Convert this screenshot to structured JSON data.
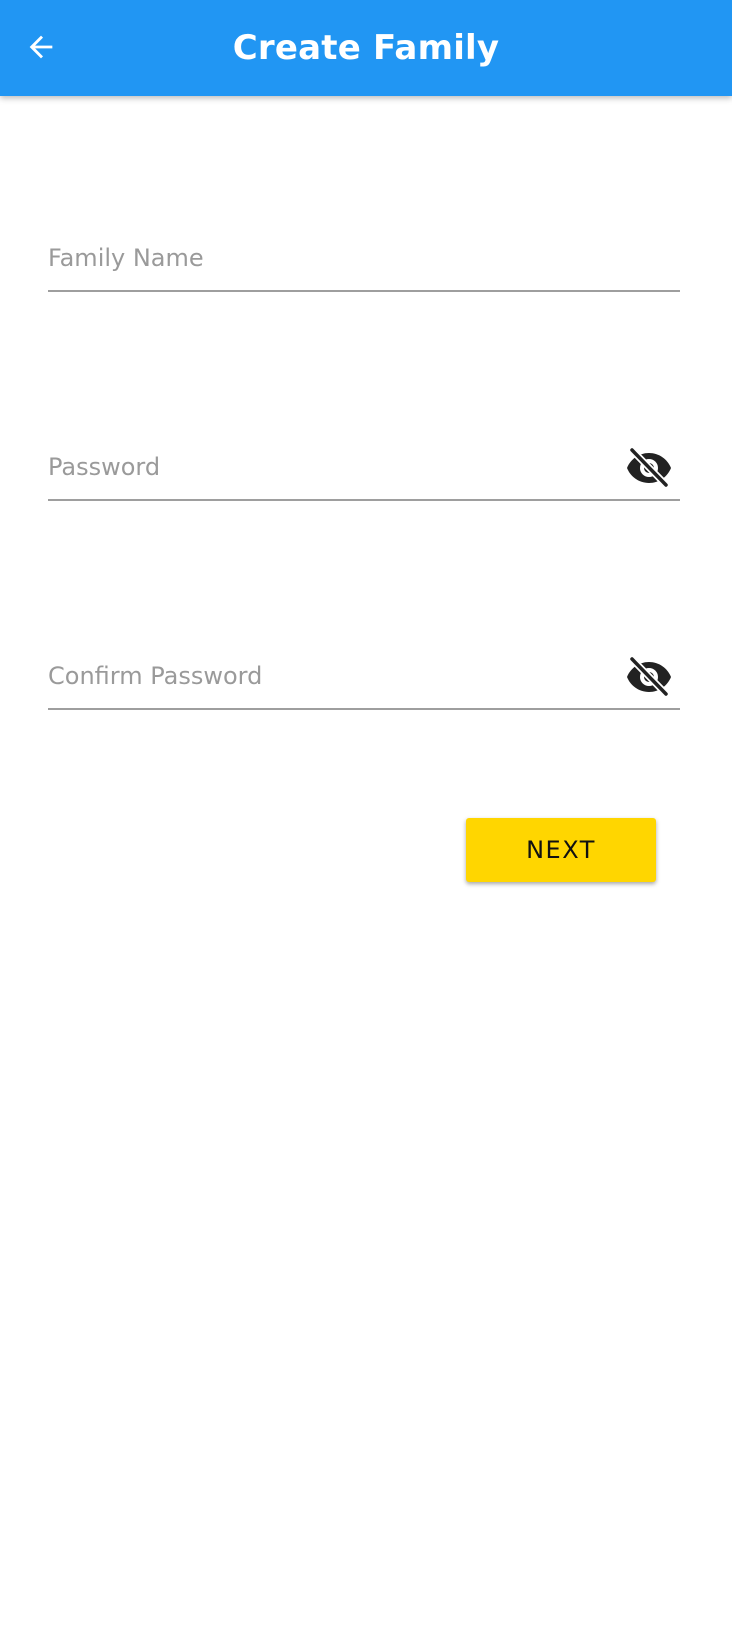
{
  "app_bar": {
    "title": "Create Family",
    "back_icon": "arrow-back-icon",
    "background_color": "#2196F3"
  },
  "form": {
    "family_name": {
      "placeholder": "Family Name",
      "value": ""
    },
    "password": {
      "placeholder": "Password",
      "value": "",
      "visibility_icon": "visibility-off-icon"
    },
    "confirm_password": {
      "placeholder": "Confirm Password",
      "value": "",
      "visibility_icon": "visibility-off-icon"
    },
    "next_button": {
      "label": "NEXT",
      "color": "#FFD600"
    }
  }
}
